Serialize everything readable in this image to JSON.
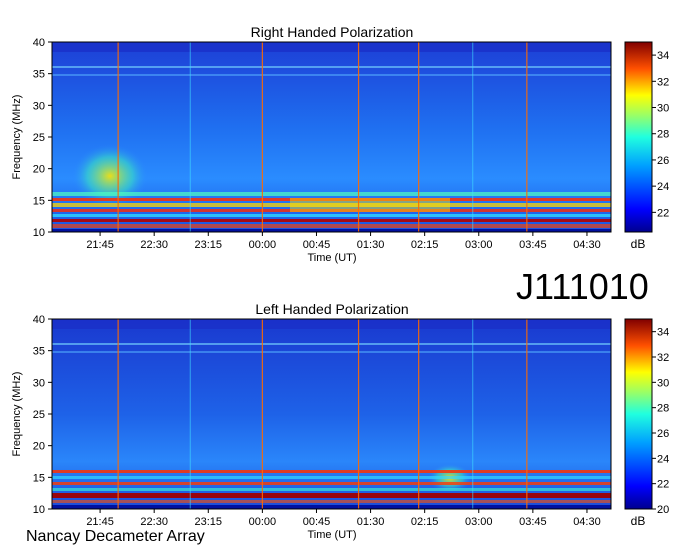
{
  "observation_id": "J111010",
  "instrument": "Nancay Decameter Array",
  "colorbar_unit": "dB",
  "colors": {
    "low": "#00008f",
    "mid": "#1e78ff",
    "high": "#ffe600",
    "max": "#8b0000",
    "marker_line": "#ff6a00"
  },
  "chart_data": [
    {
      "type": "heatmap",
      "title": "Right Handed Polarization",
      "xlabel": "Time (UT)",
      "ylabel": "Frequency (MHz)",
      "x_ticks": [
        "21:45",
        "22:30",
        "23:15",
        "00:00",
        "00:45",
        "01:30",
        "02:15",
        "03:00",
        "03:45",
        "04:30"
      ],
      "y_ticks": [
        10,
        15,
        20,
        25,
        30,
        35,
        40
      ],
      "ylim": [
        10,
        40
      ],
      "colorbar_ticks": [
        22,
        24,
        26,
        28,
        30,
        32,
        34
      ],
      "colorbar_range": [
        20.5,
        35
      ],
      "marker_times": [
        "22:00",
        "00:00",
        "01:20",
        "02:10",
        "03:40"
      ],
      "enhanced_band_MHz": [
        10,
        16
      ],
      "enhanced_level_dB": 30,
      "background_level_dB": 24
    },
    {
      "type": "heatmap",
      "title": "Left Handed Polarization",
      "xlabel": "Time (UT)",
      "ylabel": "Frequency (MHz)",
      "x_ticks": [
        "21:45",
        "22:30",
        "23:15",
        "00:00",
        "00:45",
        "01:30",
        "02:15",
        "03:00",
        "03:45",
        "04:30"
      ],
      "y_ticks": [
        10,
        15,
        20,
        25,
        30,
        35,
        40
      ],
      "ylim": [
        10,
        40
      ],
      "colorbar_ticks": [
        20,
        22,
        24,
        26,
        28,
        30,
        32,
        34
      ],
      "colorbar_range": [
        20,
        35
      ],
      "marker_times": [
        "22:00",
        "00:00",
        "01:20",
        "02:10",
        "03:40"
      ],
      "enhanced_band_MHz": [
        10,
        16
      ],
      "enhanced_level_dB": 30,
      "background_level_dB": 23
    }
  ]
}
